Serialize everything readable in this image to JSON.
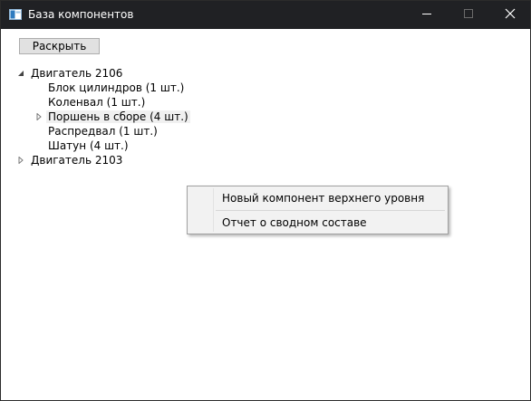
{
  "window": {
    "title": "База компонентов",
    "app_icon": "window-app-icon",
    "controls": {
      "minimize": "minimize-icon",
      "maximize": "maximize-icon",
      "close": "close-icon"
    }
  },
  "toolbar": {
    "expand_label": "Раскрыть"
  },
  "tree": {
    "nodes": [
      {
        "label": "Двигатель 2106",
        "expanded": true
      },
      {
        "label": "Блок цилиндров (1 шт.)"
      },
      {
        "label": "Коленвал (1 шт.)"
      },
      {
        "label": "Поршень в сборе (4 шт.)",
        "expanded": false
      },
      {
        "label": "Распредвал (1 шт.)"
      },
      {
        "label": "Шатун (4 шт.)"
      },
      {
        "label": "Двигатель 2103",
        "expanded": false
      }
    ]
  },
  "context_menu": {
    "items": [
      {
        "label": "Новый компонент верхнего уровня"
      },
      {
        "label": "Отчет о сводном составе"
      }
    ]
  },
  "colors": {
    "titlebar": "#202124",
    "window_bg": "#ffffff",
    "menu_bg": "#f2f2f2",
    "button_bg": "#e1e1e1"
  }
}
